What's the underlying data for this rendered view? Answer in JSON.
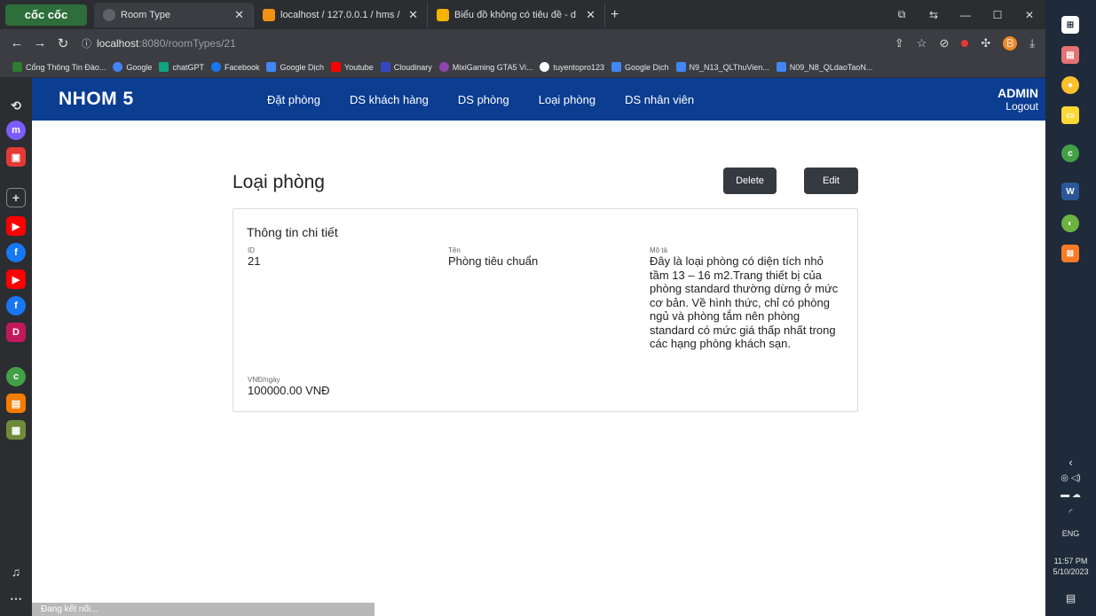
{
  "browser": {
    "logo": "cốc cốc",
    "tabs": [
      {
        "title": "Room Type",
        "icon_color": "#5f6368",
        "active": true
      },
      {
        "title": "localhost / 127.0.0.1 / hms /",
        "icon_color": "#f29111",
        "active": false
      },
      {
        "title": "Biểu đồ không có tiêu đề - d",
        "icon_color": "#f4b400",
        "active": false
      }
    ],
    "new_tab": "+",
    "url_host": "localhost",
    "url_path": ":8080/roomTypes/21",
    "profile_letter": "B",
    "bookmarks": [
      {
        "label": "Cổng Thông Tin Đào...",
        "color": "#2e7d32"
      },
      {
        "label": "Google",
        "color": "#4285f4"
      },
      {
        "label": "chatGPT",
        "color": "#10a37f"
      },
      {
        "label": "Facebook",
        "color": "#1877f2"
      },
      {
        "label": "Google Dịch",
        "color": "#4285f4"
      },
      {
        "label": "Youtube",
        "color": "#ff0000"
      },
      {
        "label": "Cloudinary",
        "color": "#3448c5"
      },
      {
        "label": "MixiGaming GTA5 Vi...",
        "color": "#8e44ad"
      },
      {
        "label": "tuyentopro123",
        "color": "#ffffff"
      },
      {
        "label": "Google Dịch",
        "color": "#4285f4"
      },
      {
        "label": "N9_N13_QLThuVien...",
        "color": "#4285f4"
      },
      {
        "label": "N09_N8_QLdaoTaoN...",
        "color": "#4285f4"
      }
    ],
    "status_text": "Đang kết nối..."
  },
  "navbar": {
    "brand": "NHOM 5",
    "links": [
      "Đặt phòng",
      "DS khách hàng",
      "DS phòng",
      "Loại phòng",
      "DS nhân viên"
    ],
    "user": "ADMIN",
    "logout": "Logout"
  },
  "main": {
    "title": "Loại phòng",
    "delete_label": "Delete",
    "edit_label": "Edit",
    "card": {
      "title": "Thông tin chi tiết",
      "id_label": "ID",
      "id_value": "21",
      "name_label": "Tên",
      "name_value": "Phòng tiêu chuẩn",
      "desc_label": "Mô tả",
      "desc_value": "Đây là loại phòng có diện tích nhỏ tầm 13 – 16 m2.Trang thiết bị của phòng standard thường dừng ở mức cơ bản. Về hình thức, chỉ có phòng ngủ và phòng tắm nên phòng standard có mức giá thấp nhất trong các hạng phòng khách sạn.",
      "price_label": "VNĐ/ngày",
      "price_value": "100000.00 VNĐ"
    }
  },
  "taskbar": {
    "language": "ENG",
    "time": "11:57 PM",
    "date": "5/10/2023"
  }
}
